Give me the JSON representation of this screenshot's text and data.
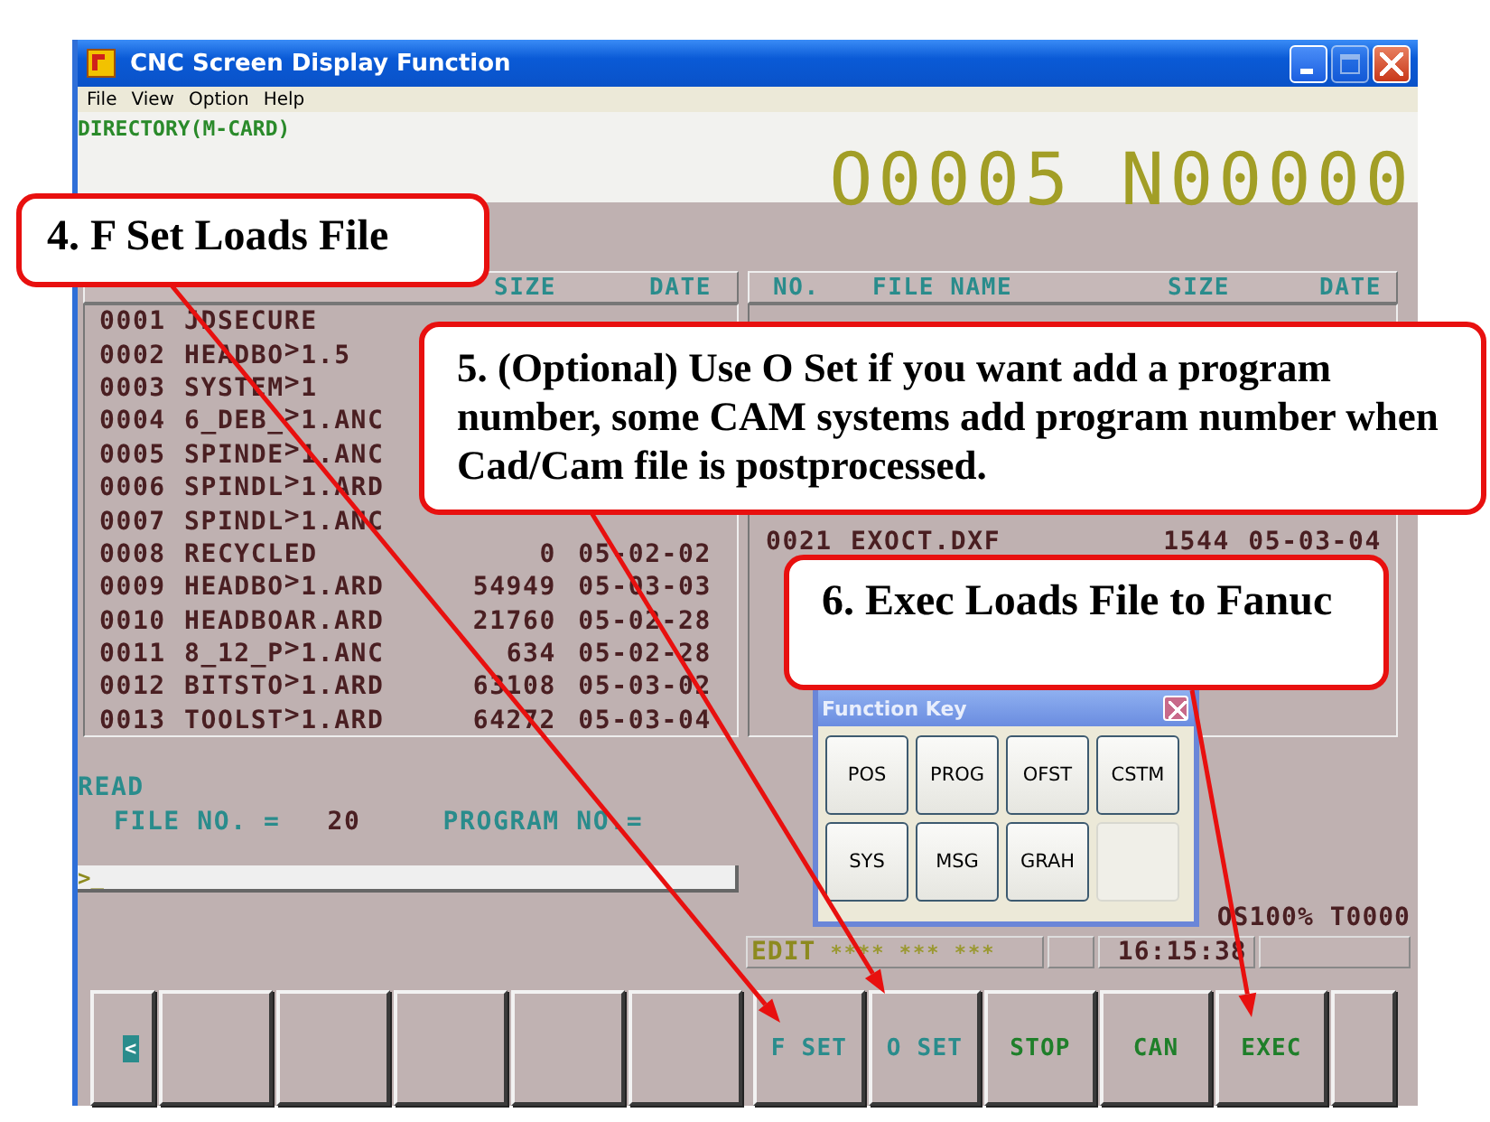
{
  "window": {
    "title": "CNC Screen Display Function"
  },
  "menu": [
    {
      "label": "File"
    },
    {
      "label": "View"
    },
    {
      "label": "Option"
    },
    {
      "label": "Help"
    }
  ],
  "screen": {
    "title": "DIRECTORY(M-CARD)",
    "program": "O0005",
    "sequence": "N00000"
  },
  "left_table": {
    "headers": {
      "size": "SIZE",
      "date": "DATE"
    },
    "rows": [
      {
        "no": "0001",
        "name": "JDSECURE"
      },
      {
        "no": "0002",
        "name": "HEADBO$^{>}$1.5"
      },
      {
        "no": "0003",
        "name": "SYSTEM$^{>}$1"
      },
      {
        "no": "0004",
        "name": "6_DEB_$^{>}$1.ANC"
      },
      {
        "no": "0005",
        "name": "SPINDE$^{>}$1.ANC"
      },
      {
        "no": "0006",
        "name": "SPINDL$^{>}$1.ARD"
      },
      {
        "no": "0007",
        "name": "SPINDL$^{>}$1.ANC"
      },
      {
        "no": "0008",
        "name": "RECYCLED",
        "size": "0",
        "date": "05-02-02"
      },
      {
        "no": "0009",
        "name": "HEADBO$^{>}$1.ARD",
        "size": "54949",
        "date": "05-03-03"
      },
      {
        "no": "0010",
        "name": "HEADBOAR.ARD",
        "size": "21760",
        "date": "05-02-28"
      },
      {
        "no": "0011",
        "name": "8_12_P$^{>}$1.ANC",
        "size": "634",
        "date": "05-02-28"
      },
      {
        "no": "0012",
        "name": "BITSTO$^{>}$1.ARD",
        "size": "63108",
        "date": "05-03-02"
      },
      {
        "no": "0013",
        "name": "TOOLST$^{>}$1.ARD",
        "size": "64272",
        "date": "05-03-04"
      }
    ]
  },
  "right_table": {
    "headers": {
      "no": "NO.",
      "name": "FILE NAME",
      "size": "SIZE",
      "date": "DATE"
    },
    "rows": [
      {
        "no": "0021",
        "name": "EXOCT.DXF",
        "size": "1544",
        "date": "05-03-04"
      }
    ]
  },
  "read": {
    "label": "READ",
    "file_no_label": "FILE NO. =",
    "file_no": "20",
    "program_no_label": "PROGRAM NO.="
  },
  "input": {
    "value": ">_"
  },
  "override": "OS100% T0000",
  "status_bar": {
    "mode": "EDIT",
    "flags": "**** *** ***",
    "time": "16:15:38"
  },
  "softkeys": [
    {
      "kind": "nav",
      "label": "<"
    },
    {
      "kind": "blank"
    },
    {
      "kind": "blank"
    },
    {
      "kind": "blank"
    },
    {
      "kind": "blank"
    },
    {
      "kind": "blank"
    },
    {
      "kind": "key",
      "label": "F SET",
      "color": "#2a8c8c"
    },
    {
      "kind": "key",
      "label": "O SET",
      "color": "#2a8c8c"
    },
    {
      "kind": "key",
      "label": "STOP",
      "color": "#1f7f2a"
    },
    {
      "kind": "key",
      "label": "CAN",
      "color": "#1f7f2a"
    },
    {
      "kind": "key",
      "label": "EXEC",
      "color": "#1f7f2a"
    },
    {
      "kind": "blank"
    }
  ],
  "function_key_panel": {
    "title": "Function Key",
    "keys": [
      {
        "kind": "key",
        "label": "POS"
      },
      {
        "kind": "key",
        "label": "PROG"
      },
      {
        "kind": "key",
        "label": "OFST"
      },
      {
        "kind": "key",
        "label": "CSTM"
      },
      {
        "kind": "key",
        "label": "SYS"
      },
      {
        "kind": "key",
        "label": "MSG"
      },
      {
        "kind": "key",
        "label": "GRAH"
      },
      {
        "kind": "empty"
      }
    ]
  },
  "callouts": [
    {
      "text": "4. F Set Loads File"
    },
    {
      "text": "5. (Optional) Use O Set if you want add a program number, some CAM systems add program number when Cad/Cam file is postprocessed."
    },
    {
      "text": "6. Exec Loads File to Fanuc"
    }
  ]
}
